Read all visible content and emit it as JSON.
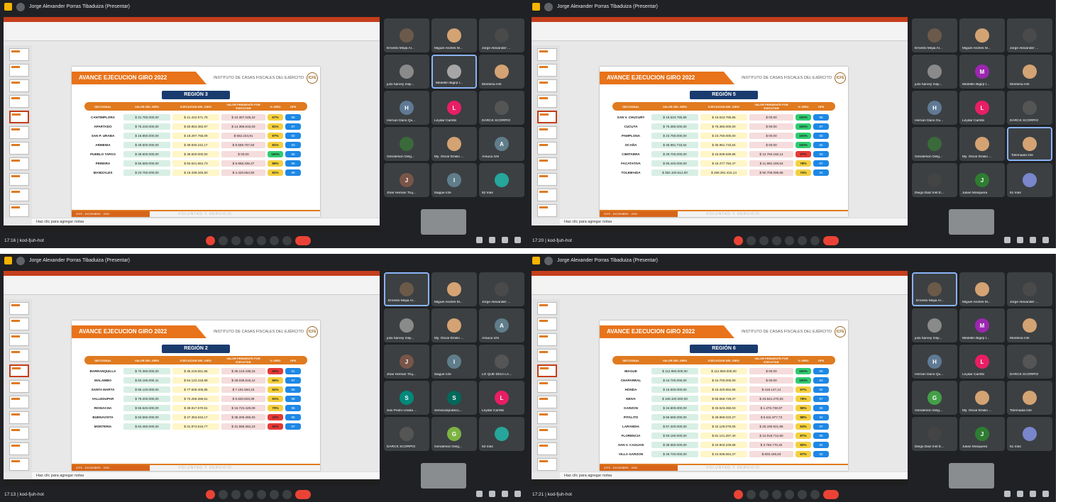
{
  "quadrants": [
    {
      "id": "tl",
      "presenter": "Jorge Alexander Porras Tibaduiza (Presentar)",
      "time_meeting": "17:16 | kod-fjuh-hot",
      "slide": {
        "banner": "AVANCE EJECUCION GIRO 2022",
        "institute": "INSTITUTO DE CASAS FISCALES DEL EJÉRCITO",
        "logo": "ICFE",
        "region": "REGIÓN 3",
        "headers": [
          "SECCIONAL",
          "VALOR DEL GIRO",
          "EJECUCION DEL GIRO",
          "VALOR PENDIENTE POR EJECUTAR",
          "% GIRO",
          "OPS"
        ],
        "rows": [
          {
            "name": "CANTIMPLORA",
            "valor": "$ 31.780.000,00",
            "ejec": "$ 21.422.971,78",
            "pend": "$ 10.357.028,22",
            "pct": "67%",
            "pctColor": "#f4d03f",
            "ops": "06"
          },
          {
            "name": "APARTADO",
            "valor": "$ 75.240.000,00",
            "ejec": "$ 60.853.383,97",
            "pend": "$ 14.386.616,03",
            "pct": "81%",
            "pctColor": "#f4d03f",
            "ops": "07"
          },
          {
            "name": "SAN P. URABA",
            "valor": "$ 18.860.000,00",
            "ejec": "$ 18.297.765,09",
            "pend": "$ 562.234,91",
            "pct": "97%",
            "pctColor": "#f4d03f",
            "ops": "02"
          },
          {
            "name": "ARMENIA",
            "valor": "$ 49.500.000,00",
            "ejec": "$ 39.930.242,17",
            "pend": "$ 9.569.757,83",
            "pct": "81%",
            "pctColor": "#f4d03f",
            "ops": "03"
          },
          {
            "name": "PUEBLO TAPAO",
            "valor": "$ 39.600.000,00",
            "ejec": "$ 39.600.000,00",
            "pend": "$ 00.00",
            "pct": "100%",
            "pctColor": "#2ecc71",
            "ops": "06"
          },
          {
            "name": "PEREIRA",
            "valor": "$ 56.580.000,00",
            "ejec": "$ 50.621.664,73",
            "pend": "$ 5.958.335,27",
            "pct": "89%",
            "pctColor": "#f4d03f",
            "ops": "06"
          },
          {
            "name": "MANIZALES",
            "valor": "$ 23.760.000,00",
            "ejec": "$ 19.339.345,50",
            "pend": "$ 4.420.654,50",
            "pct": "81%",
            "pctColor": "#f4d03f",
            "ops": "08"
          }
        ],
        "footer_left": "ICFE - DICIEMBRE - 2022",
        "footer_right": "VOLUNTAD Y SERVICIO"
      },
      "notes": "Haz clic para agregar notas",
      "tiles": [
        {
          "name": "Ernesto Mejia Ar...",
          "initial": "",
          "color": "#6b5a4a",
          "active": false
        },
        {
          "name": "Miguel Andres M...",
          "initial": "",
          "color": "#d4a373",
          "active": false
        },
        {
          "name": "Jorge Alexander ...",
          "initial": "",
          "color": "#4a4a4a",
          "active": false
        },
        {
          "name": "julio harvey meji...",
          "initial": "",
          "color": "#8a8a8a",
          "active": false
        },
        {
          "name": "Medellin Bigirp I...",
          "initial": "",
          "color": "#a6a6a6",
          "active": true
        },
        {
          "name": "Monteria Icfe",
          "initial": "",
          "color": "#d4a373",
          "active": false
        },
        {
          "name": "Hernan Dario Qu...",
          "initial": "H",
          "color": "#5f7a94",
          "active": false
        },
        {
          "name": "Leydar Carrillo",
          "initial": "L",
          "color": "#e91e63",
          "active": false
        },
        {
          "name": "DARCK SCORPIO",
          "initial": "",
          "color": "#555",
          "active": false
        },
        {
          "name": "Genderson Delg...",
          "initial": "",
          "color": "#3a6a3a",
          "active": false
        },
        {
          "name": "My. Oscar Emilio ...",
          "initial": "",
          "color": "#d4a373",
          "active": false
        },
        {
          "name": "Arauca Icfe",
          "initial": "A",
          "color": "#607d8b",
          "active": false
        },
        {
          "name": "Jhair Hernan Truj...",
          "initial": "J",
          "color": "#795548",
          "active": false
        },
        {
          "name": "Ibague Icfe",
          "initial": "I",
          "color": "#607d8b",
          "active": false
        },
        {
          "name": "52 más",
          "initial": "",
          "color": "#26a69a",
          "active": false
        }
      ]
    },
    {
      "id": "tr",
      "presenter": "Jorge Alexander Porras Tibaduiza (Presentar)",
      "time_meeting": "17:20 | kod-fjuh-hot",
      "slide": {
        "banner": "AVANCE EJECUCION GIRO 2022",
        "institute": "INSTITUTO DE CASAS FISCALES DEL EJÉRCITO",
        "logo": "ICFE",
        "region": "REGIÓN 5",
        "headers": [
          "SECCIONAL",
          "VALOR DEL GIRO",
          "EJECUCION DEL GIRO",
          "VALOR PENDIENTE POR EJECUTAR",
          "% GIRO",
          "OPS"
        ],
        "rows": [
          {
            "name": "SAN V. CHUCURY",
            "valor": "$ 16.543.785,85",
            "ejec": "$ 16.543.785,85",
            "pend": "$ 00.00",
            "pct": "100%",
            "pctColor": "#2ecc71",
            "ops": "06"
          },
          {
            "name": "CUCUTA",
            "valor": "$ 76.380.000,00",
            "ejec": "$ 76.380.000,00",
            "pend": "$ 00.00",
            "pct": "100%",
            "pctColor": "#2ecc71",
            "ops": "07"
          },
          {
            "name": "PAMPLONA",
            "valor": "$ 23.760.000,00",
            "ejec": "$ 23.760.000,00",
            "pend": "$ 00.00",
            "pct": "100%",
            "pctColor": "#2ecc71",
            "ops": "03"
          },
          {
            "name": "OCAÑA",
            "valor": "$ 35.981.733,64",
            "ejec": "$ 35.981.733,64",
            "pend": "$ 00.00",
            "pct": "100%",
            "pctColor": "#2ecc71",
            "ops": "04"
          },
          {
            "name": "CIMITARRA",
            "valor": "$ 29.700.000,00",
            "ejec": "$ 16.939.839,86",
            "pend": "$ 12.760.160,14",
            "pct": "57%",
            "pctColor": "#e53935",
            "ops": "03"
          },
          {
            "name": "FACATATIVA",
            "valor": "$ 55.440.000,00",
            "ejec": "$ 43.477.760,47",
            "pend": "$ 11.992.239,53",
            "pct": "78%",
            "pctColor": "#f4d03f",
            "ops": "07"
          },
          {
            "name": "TOLEMAIDA",
            "valor": "$ 352.100.512,00",
            "ejec": "$ 259.391.415,14",
            "pend": "$ 92.709.096,86",
            "pct": "74%",
            "pctColor": "#f4d03f",
            "ops": "24"
          }
        ],
        "footer_left": "ICFE - DICIEMBRE - 2022",
        "footer_right": "VOLUNTAD Y SERVICIO"
      },
      "notes": "Haz clic para agregar notas",
      "tiles": [
        {
          "name": "Ernesto Mejia Ar...",
          "initial": "",
          "color": "#6b5a4a",
          "active": false
        },
        {
          "name": "Miguel Andres M...",
          "initial": "",
          "color": "#d4a373",
          "active": false
        },
        {
          "name": "Jorge Alexander ...",
          "initial": "",
          "color": "#4a4a4a",
          "active": false
        },
        {
          "name": "julio harvey meji...",
          "initial": "",
          "color": "#8a8a8a",
          "active": false
        },
        {
          "name": "Medellin Bigirp I...",
          "initial": "M",
          "color": "#9c27b0",
          "active": false
        },
        {
          "name": "Monteria Icfe",
          "initial": "",
          "color": "#d4a373",
          "active": false
        },
        {
          "name": "Hernan Dario Gu...",
          "initial": "H",
          "color": "#5f7a94",
          "active": false
        },
        {
          "name": "Leydar Carrillo",
          "initial": "L",
          "color": "#e91e63",
          "active": false
        },
        {
          "name": "DARCK SCORPIO",
          "initial": "",
          "color": "#555",
          "active": false
        },
        {
          "name": "Genderson Delg...",
          "initial": "",
          "color": "#3a6a3a",
          "active": false
        },
        {
          "name": "My. Oscar Emilio ...",
          "initial": "",
          "color": "#d4a373",
          "active": false
        },
        {
          "name": "Tolemaida Icfe",
          "initial": "",
          "color": "#d4a373",
          "active": true
        },
        {
          "name": "Diego Diaz Inst E...",
          "initial": "",
          "color": "#444",
          "active": false
        },
        {
          "name": "Julian Mosquera",
          "initial": "J",
          "color": "#2e7d32",
          "active": false
        },
        {
          "name": "51 más",
          "initial": "",
          "color": "#7986cb",
          "active": false
        }
      ]
    },
    {
      "id": "bl",
      "presenter": "Jorge Alexander Porras Tibaduiza (Presentar)",
      "time_meeting": "17:13 | kod-fjuh-hot",
      "slide": {
        "banner": "AVANCE EJECUCION GIRO 2022",
        "institute": "INSTITUTO DE CASAS FISCALES DEL EJÉRCITO",
        "logo": "ICFE",
        "region": "REGIÓN 2",
        "headers": [
          "SECCIONAL",
          "VALOR DEL GIRO",
          "EJECUCION DEL GIRO",
          "VALOR PENDIENTE POR EJECUTAR",
          "% GIRO",
          "OPS"
        ],
        "rows": [
          {
            "name": "BARRANQUILLA",
            "valor": "$ 70.360.000,00",
            "ejec": "$ 35.216.561,85",
            "pend": "$ 35.143.438,15",
            "pct": "50%",
            "pctColor": "#e53935",
            "ops": "01"
          },
          {
            "name": "MALAMBO",
            "valor": "$ 83.160.000,41",
            "ejec": "$ 54.123.418,88",
            "pend": "$ 29.036.518,12",
            "pct": "65%",
            "pctColor": "#f4d03f",
            "ops": "07"
          },
          {
            "name": "SANTA MARTA",
            "valor": "$ 85.140.000,00",
            "ejec": "$ 77.948.405,85",
            "pend": "$ 7.191.594,15",
            "pct": "92%",
            "pctColor": "#f4d03f",
            "ops": "05"
          },
          {
            "name": "VALLEDUPAR",
            "valor": "$ 79.200.000,00",
            "ejec": "$ 72.259.396,61",
            "pend": "$ 6.940.603,39",
            "pct": "91%",
            "pctColor": "#f4d03f",
            "ops": "08"
          },
          {
            "name": "RIOHACHA",
            "valor": "$ 55.640.000,00",
            "ejec": "$ 38.917.570,91",
            "pend": "$ 16.722.429,09",
            "pct": "70%",
            "pctColor": "#f4d03f",
            "ops": "06"
          },
          {
            "name": "BUENAVISTA",
            "valor": "$ 63.560.000,00",
            "ejec": "$ 27.353.634,17",
            "pend": "$ 36.206.365,83",
            "pct": "43%",
            "pctColor": "#e53935",
            "ops": "05"
          },
          {
            "name": "MONTERIA",
            "valor": "$ 63.460.000,00",
            "ejec": "$ 31.874.615,77",
            "pend": "$ 31.585.384,23",
            "pct": "50%",
            "pctColor": "#e53935",
            "ops": "07"
          }
        ],
        "footer_left": "ICFE - DICIEMBRE - 2022",
        "footer_right": "VOLUNTAD Y SERVICIO"
      },
      "notes": "Haz clic para agregar notas",
      "tiles": [
        {
          "name": "Ernesto Mejia Ar...",
          "initial": "",
          "color": "#6b5a4a",
          "active": true
        },
        {
          "name": "Miguel Andres M...",
          "initial": "",
          "color": "#d4a373",
          "active": false
        },
        {
          "name": "Jorge Alexander ...",
          "initial": "",
          "color": "#4a4a4a",
          "active": false
        },
        {
          "name": "julio harvey meji...",
          "initial": "",
          "color": "#8a8a8a",
          "active": false
        },
        {
          "name": "My. Oscar Emilio ...",
          "initial": "",
          "color": "#d4a373",
          "active": false
        },
        {
          "name": "Arauca Icfe",
          "initial": "A",
          "color": "#607d8b",
          "active": false
        },
        {
          "name": "Jhair Hernan Truj...",
          "initial": "J",
          "color": "#795548",
          "active": false
        },
        {
          "name": "Ibague Icfe",
          "initial": "I",
          "color": "#607d8b",
          "active": false
        },
        {
          "name": "LO QUE DIGA LA...",
          "initial": "",
          "color": "#555",
          "active": false
        },
        {
          "name": "San Pedro Uraba ...",
          "initial": "S",
          "color": "#00897b",
          "active": false
        },
        {
          "name": "Serviciospublico...",
          "initial": "S",
          "color": "#00695c",
          "active": false
        },
        {
          "name": "Leydar Carrillo",
          "initial": "L",
          "color": "#e91e63",
          "active": false
        },
        {
          "name": "DARCK SCORPIO",
          "initial": "",
          "color": "#555",
          "active": false
        },
        {
          "name": "Genderson Delg...",
          "initial": "G",
          "color": "#7cb342",
          "active": false
        },
        {
          "name": "53 más",
          "initial": "",
          "color": "#26a69a",
          "active": false
        }
      ]
    },
    {
      "id": "br",
      "presenter": "Jorge Alexander Porras Tibaduiza (Presentar)",
      "time_meeting": "17:21 | kod-fjuh-hot",
      "slide": {
        "banner": "AVANCE EJECUCION GIRO 2022",
        "institute": "INSTITUTO DE CASAS FISCALES DEL EJÉRCITO",
        "logo": "ICFE",
        "region": "REGIÓN 6",
        "headers": [
          "SECCIONAL",
          "VALOR DEL GIRO",
          "EJECUCION DEL GIRO",
          "VALOR PENDIENTE POR EJECUTAR",
          "% GIRO",
          "OPS"
        ],
        "rows": [
          {
            "name": "IBAGUE",
            "valor": "$ 112.960.000,00",
            "ejec": "$ 112.960.000,00",
            "pend": "$ 00.00",
            "pct": "100%",
            "pctColor": "#2ecc71",
            "ops": "09"
          },
          {
            "name": "CHAPARRAL",
            "valor": "$ 44.700.000,00",
            "ejec": "$ 44.700.000,00",
            "pend": "$ 00.00",
            "pct": "100%",
            "pctColor": "#2ecc71",
            "ops": "03"
          },
          {
            "name": "HONDA",
            "valor": "$ 15.840.000,00",
            "ejec": "$ 15.420.852,86",
            "pend": "$ 419.147,14",
            "pct": "97%",
            "pctColor": "#f4d03f",
            "ops": "02"
          },
          {
            "name": "NEIVA",
            "valor": "$ 109.100.000,00",
            "ejec": "$ 85.558.729,47",
            "pend": "$ 23.541.270,53",
            "pct": "78%",
            "pctColor": "#f4d03f",
            "ops": "07"
          },
          {
            "name": "GARZON",
            "valor": "$ 34.800.000,00",
            "ejec": "$ 33.523.260,03",
            "pend": "$ 1.276.739,97",
            "pct": "96%",
            "pctColor": "#f4d03f",
            "ops": "06"
          },
          {
            "name": "PITALITO",
            "valor": "$ 56.580.000,00",
            "ejec": "$ 49.968.022,27",
            "pend": "$ 6.611.977,73",
            "pct": "88%",
            "pctColor": "#f4d03f",
            "ops": "04"
          },
          {
            "name": "LARANDIA",
            "valor": "$ 67.320.000,00",
            "ejec": "$ 42.129.078,05",
            "pend": "$ 25.190.921,95",
            "pct": "63%",
            "pctColor": "#f4d03f",
            "ops": "07"
          },
          {
            "name": "FLORENCIA",
            "valor": "$ 93.160.000,00",
            "ejec": "$ 81.141.287,40",
            "pend": "$ 12.018.712,60",
            "pct": "87%",
            "pctColor": "#f4d03f",
            "ops": "05"
          },
          {
            "name": "SAN V. CAGUAN",
            "valor": "$ 38.660.000,00",
            "ejec": "$ 34.903.229,68",
            "pend": "$ 3.756.770,32",
            "pct": "90%",
            "pctColor": "#f4d03f",
            "ops": "04"
          },
          {
            "name": "VILLA GARZON",
            "valor": "$ 25.740.000,00",
            "ejec": "$ 24.936.564,37",
            "pend": "$ 803.435,63",
            "pct": "97%",
            "pctColor": "#f4d03f",
            "ops": "02"
          }
        ],
        "footer_left": "ICFE - DICIEMBRE - 2022",
        "footer_right": "VOLUNTAD Y SERVICIO"
      },
      "notes": "Haz clic para agregar notas",
      "tiles": [
        {
          "name": "Ernesto Mejia Ar...",
          "initial": "",
          "color": "#6b5a4a",
          "active": true
        },
        {
          "name": "Miguel Andres M...",
          "initial": "",
          "color": "#d4a373",
          "active": false
        },
        {
          "name": "Jorge Alexander ...",
          "initial": "",
          "color": "#4a4a4a",
          "active": false
        },
        {
          "name": "julio harvey meji...",
          "initial": "",
          "color": "#8a8a8a",
          "active": false
        },
        {
          "name": "Medellin Bigirp I...",
          "initial": "M",
          "color": "#9c27b0",
          "active": false
        },
        {
          "name": "Monteria Icfe",
          "initial": "",
          "color": "#d4a373",
          "active": false
        },
        {
          "name": "Hernan Dario Qu...",
          "initial": "H",
          "color": "#5f7a94",
          "active": false
        },
        {
          "name": "Leydar Carrillo",
          "initial": "L",
          "color": "#e91e63",
          "active": false
        },
        {
          "name": "DARCK SCORPIO",
          "initial": "",
          "color": "#555",
          "active": false
        },
        {
          "name": "Genderson Delg...",
          "initial": "G",
          "color": "#43a047",
          "active": false
        },
        {
          "name": "My. Oscar Emilio ...",
          "initial": "",
          "color": "#d4a373",
          "active": false
        },
        {
          "name": "Tolemaida Icfe",
          "initial": "",
          "color": "#d4a373",
          "active": false
        },
        {
          "name": "Diego Diaz Inst E...",
          "initial": "",
          "color": "#444",
          "active": false
        },
        {
          "name": "Julian Mosquera",
          "initial": "J",
          "color": "#2e7d32",
          "active": false
        },
        {
          "name": "51 más",
          "initial": "",
          "color": "#7986cb",
          "active": false
        }
      ]
    }
  ]
}
